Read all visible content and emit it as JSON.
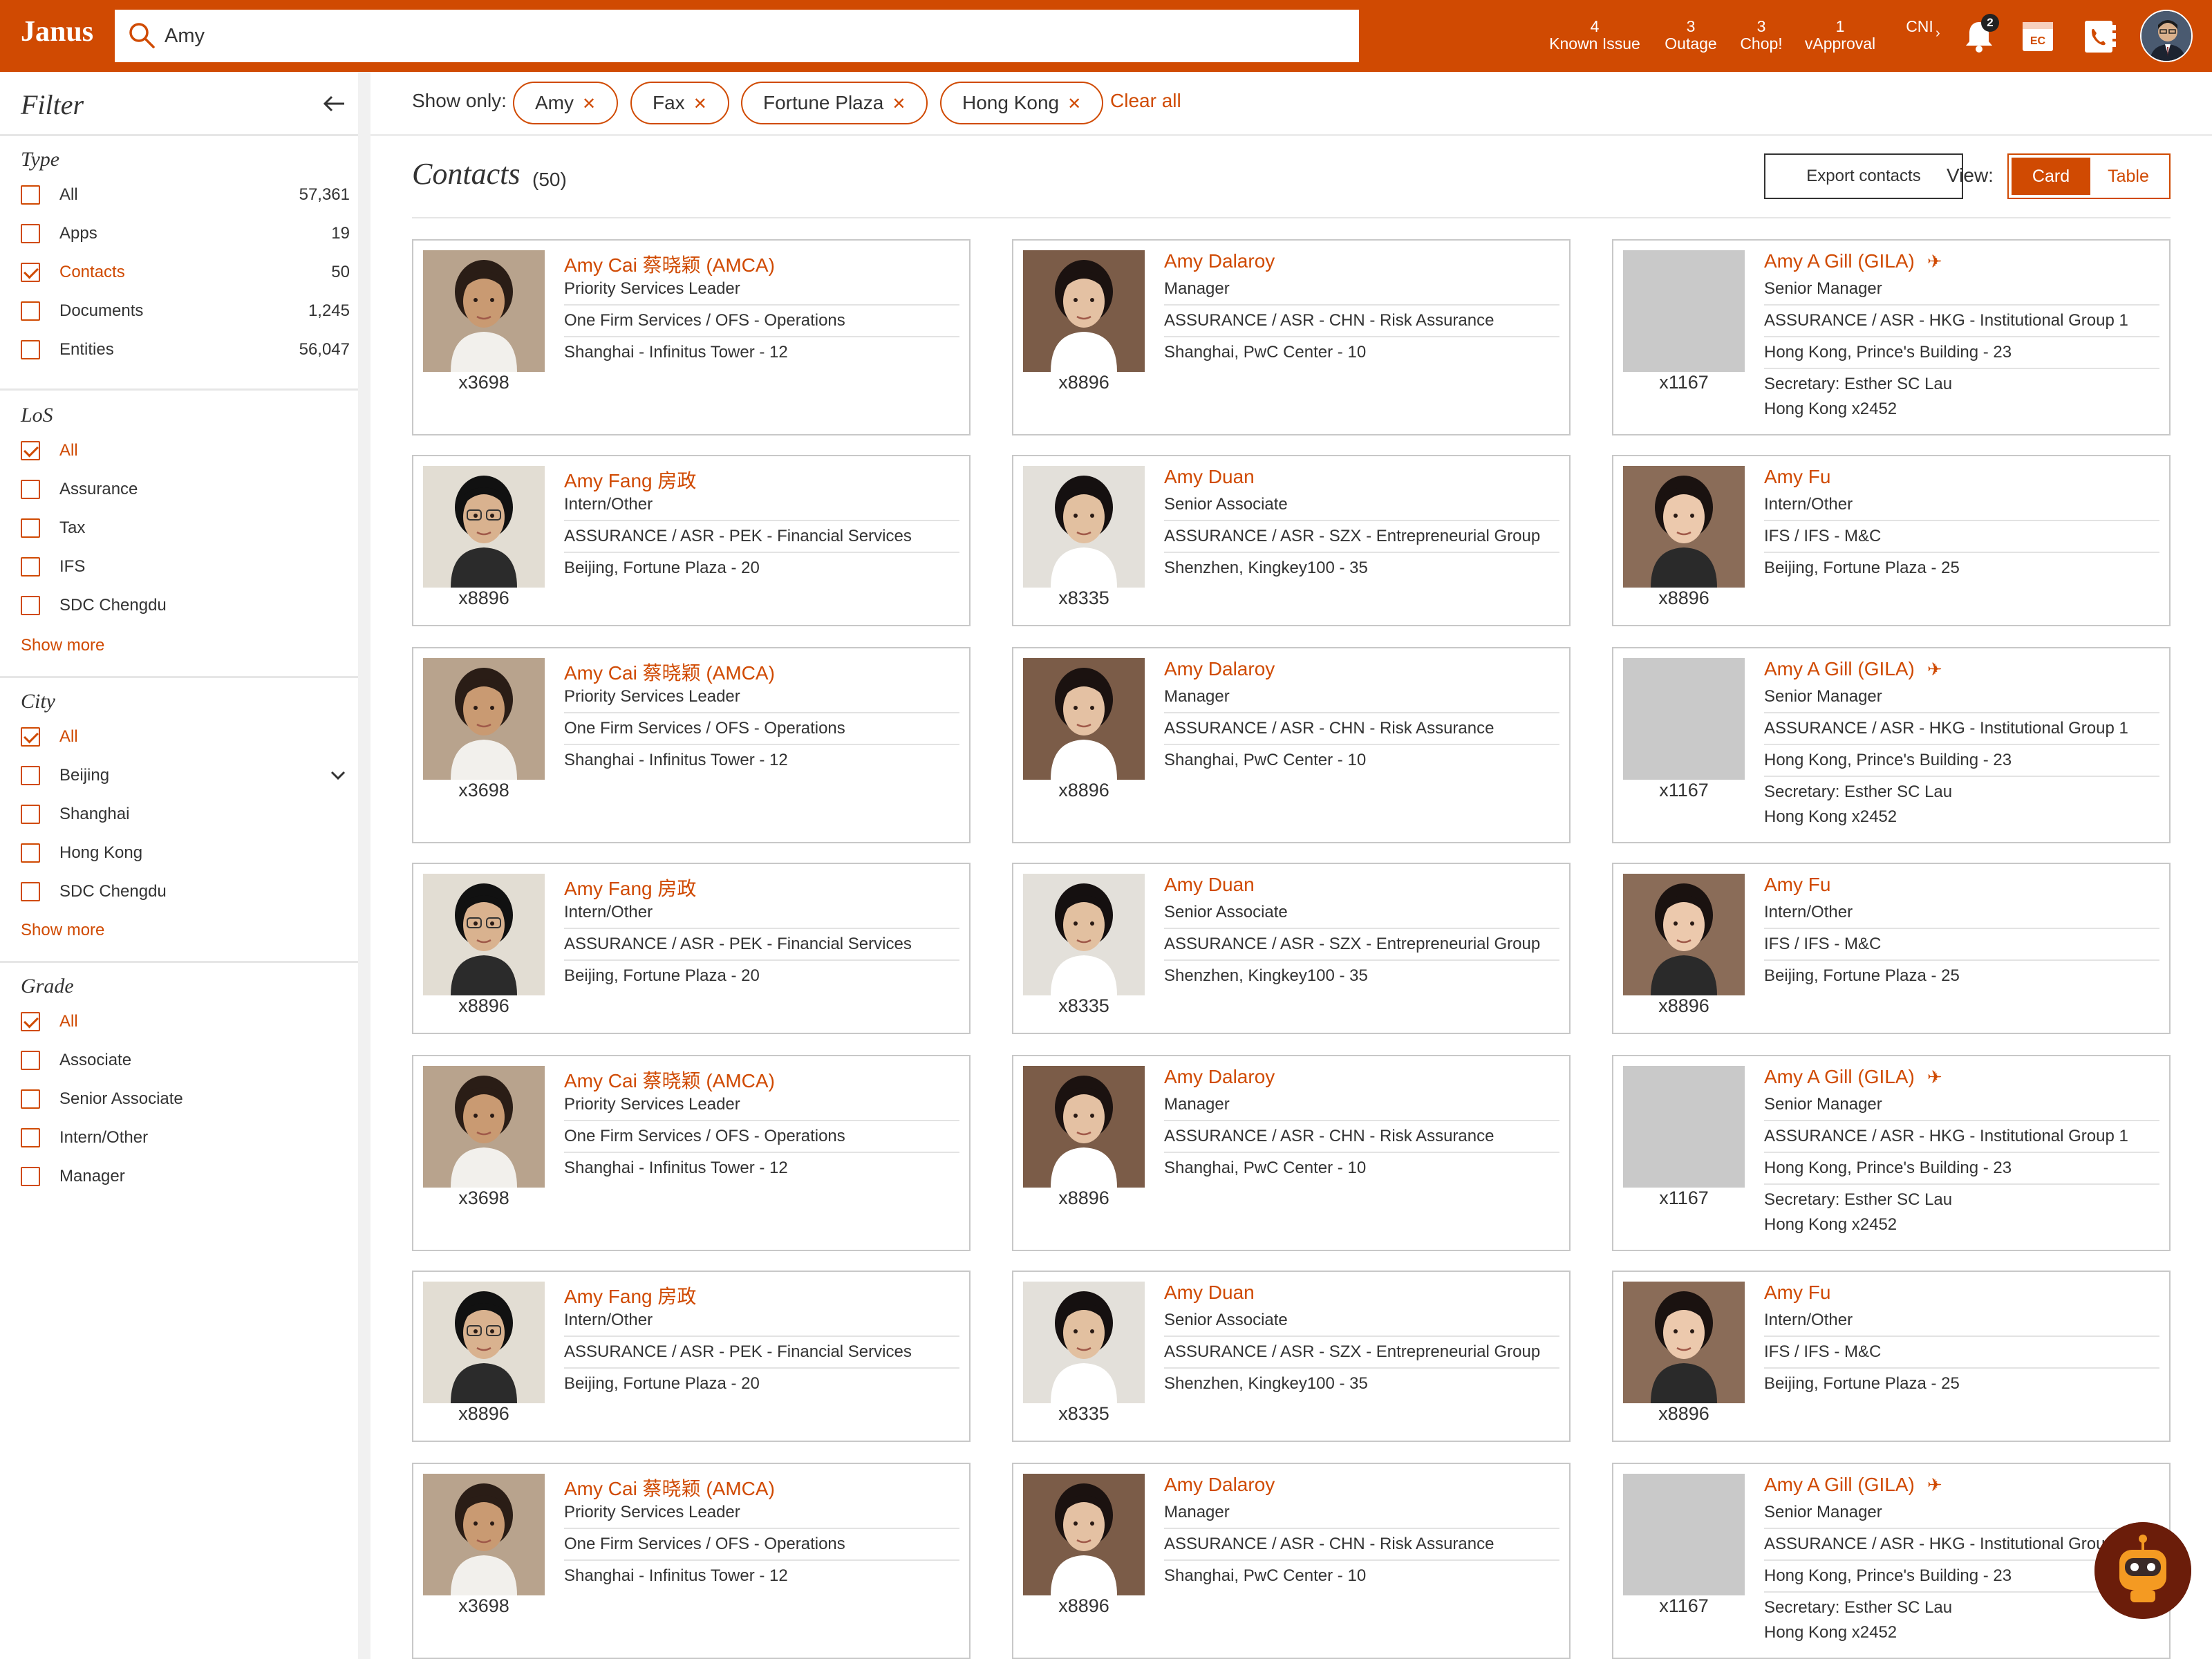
{
  "app": {
    "brand": "Janus"
  },
  "search": {
    "value": "Amy",
    "placeholder": ""
  },
  "topbar": {
    "stats": [
      {
        "count": "4",
        "label": "Known Issue"
      },
      {
        "count": "3",
        "label": "Outage"
      },
      {
        "count": "3",
        "label": "Chop!"
      },
      {
        "count": "1",
        "label": "vApproval"
      },
      {
        "count": "",
        "label": "CNI"
      }
    ],
    "bell_badge": "2",
    "ec_label": "EC"
  },
  "sidebar": {
    "title": "Filter",
    "sections": [
      {
        "title": "Type",
        "options": [
          {
            "label": "All",
            "count": "57,361",
            "checked": false
          },
          {
            "label": "Apps",
            "count": "19",
            "checked": false
          },
          {
            "label": "Contacts",
            "count": "50",
            "checked": true
          },
          {
            "label": "Documents",
            "count": "1,245",
            "checked": false
          },
          {
            "label": "Entities",
            "count": "56,047",
            "checked": false
          }
        ]
      },
      {
        "title": "LoS",
        "show_more": "Show more",
        "options": [
          {
            "label": "All",
            "count": "",
            "checked": true
          },
          {
            "label": "Assurance",
            "count": "",
            "checked": false
          },
          {
            "label": "Tax",
            "count": "",
            "checked": false
          },
          {
            "label": "IFS",
            "count": "",
            "checked": false
          },
          {
            "label": "SDC Chengdu",
            "count": "",
            "checked": false
          }
        ]
      },
      {
        "title": "City",
        "show_more": "Show more",
        "options": [
          {
            "label": "All",
            "count": "",
            "checked": true
          },
          {
            "label": "Beijing",
            "count": "",
            "checked": false
          },
          {
            "label": "Shanghai",
            "count": "",
            "checked": false
          },
          {
            "label": "Hong Kong",
            "count": "",
            "checked": false
          },
          {
            "label": "SDC Chengdu",
            "count": "",
            "checked": false
          }
        ]
      },
      {
        "title": "Grade",
        "options": [
          {
            "label": "All",
            "count": "",
            "checked": true
          },
          {
            "label": "Associate",
            "count": "",
            "checked": false
          },
          {
            "label": "Senior Associate",
            "count": "",
            "checked": false
          },
          {
            "label": "Intern/Other",
            "count": "",
            "checked": false
          },
          {
            "label": "Manager",
            "count": "",
            "checked": false
          }
        ]
      }
    ]
  },
  "filters": {
    "show_only_label": "Show only:",
    "chips": [
      "Amy",
      "Fax",
      "Fortune Plaza",
      "Hong Kong"
    ],
    "clear_all": "Clear all"
  },
  "contacts": {
    "title": "Contacts",
    "count": "(50)",
    "export_label": "Export contacts",
    "view_label": "View:",
    "view_card": "Card",
    "view_table": "Table",
    "cards": [
      {
        "name": "Amy Cai 蔡晓颖 (AMCA)",
        "title": "Priority Services Leader",
        "dept": "One Firm Services / OFS - Operations",
        "location": "Shanghai - Infinitus Tower - 12",
        "ext": "x3698",
        "photo": "p1"
      },
      {
        "name": "Amy Dalaroy",
        "title": "Manager",
        "dept": "ASSURANCE / ASR - CHN - Risk Assurance",
        "location": "Shanghai, PwC Center - 10",
        "ext": "x8896",
        "photo": "p2"
      },
      {
        "name": "Amy A Gill (GILA)",
        "title": "Senior Manager",
        "dept": "ASSURANCE / ASR - HKG - Institutional Group 1",
        "location": "Hong Kong, Prince's Building - 23",
        "secretary": "Secretary: Esther SC Lau",
        "secretary_ext": "Hong Kong x2452",
        "ext": "x1167",
        "photo": "none",
        "travel_icon": true
      },
      {
        "name": "Amy Fang 房政",
        "title": "Intern/Other",
        "dept": "ASSURANCE / ASR - PEK - Financial Services",
        "location": "Beijing, Fortune Plaza - 20",
        "ext": "x8896",
        "photo": "p3"
      },
      {
        "name": "Amy Duan",
        "title": "Senior Associate",
        "dept": "ASSURANCE / ASR - SZX - Entrepreneurial Group",
        "location": "Shenzhen, Kingkey100 - 35",
        "ext": "x8335",
        "photo": "p4"
      },
      {
        "name": "Amy Fu",
        "title": "Intern/Other",
        "dept": "IFS / IFS - M&C",
        "location": "Beijing, Fortune Plaza - 25",
        "ext": "x8896",
        "photo": "p5"
      }
    ]
  },
  "colors": {
    "accent": "#d04a02",
    "border": "#c8c8c8"
  }
}
